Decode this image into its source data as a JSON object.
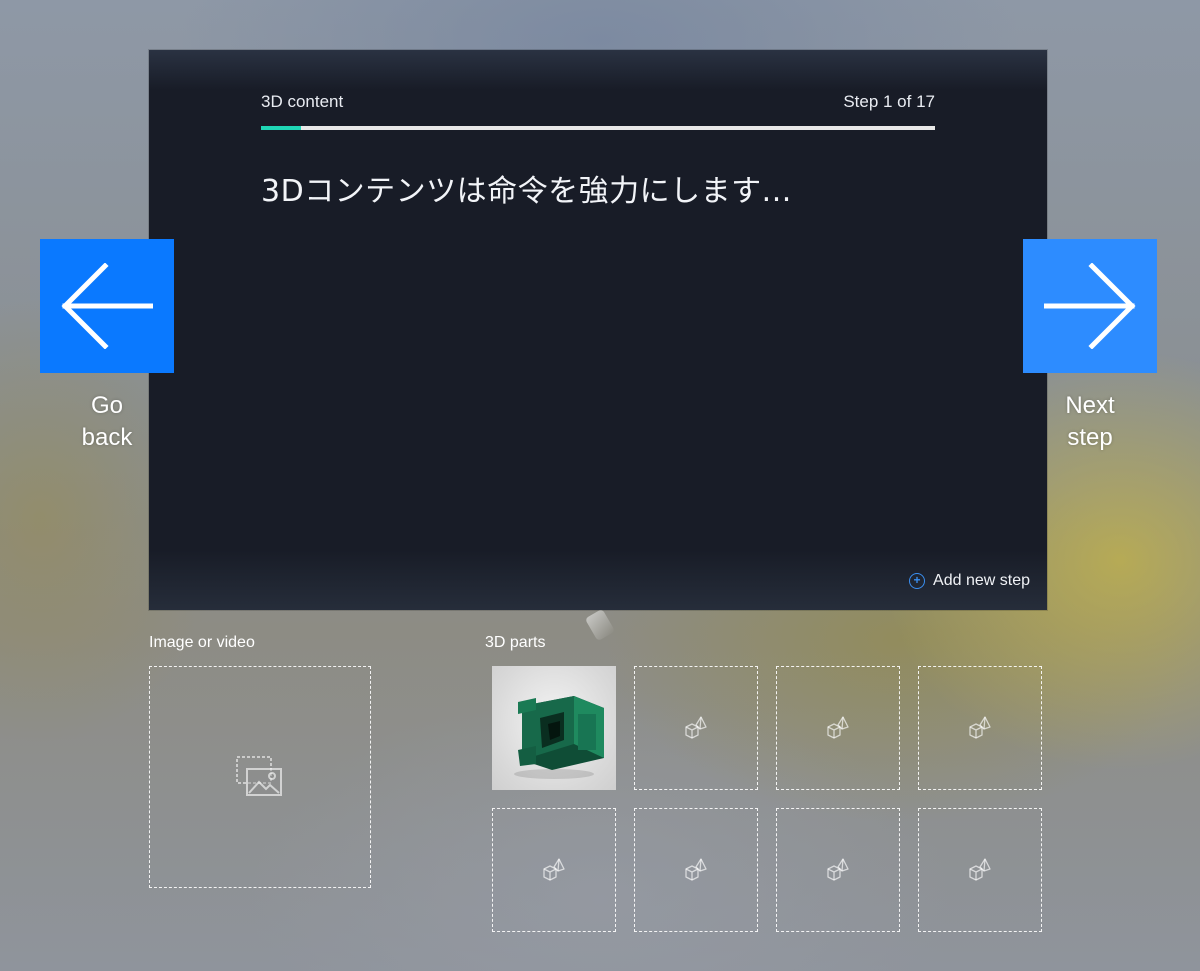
{
  "card": {
    "section_title": "3D content",
    "step_counter": "Step 1 of 17",
    "progress": {
      "current_step": 1,
      "total_steps": 17,
      "fraction": 0.06,
      "color": "#1fd6b5"
    },
    "instruction": "3Dコンテンツは命令を強力にします...",
    "add_step_label": "Add new step"
  },
  "nav": {
    "back_label_line1": "Go",
    "back_label_line2": "back",
    "next_label_line1": "Next",
    "next_label_line2": "step",
    "back_color": "#0a79ff",
    "next_color": "#2d8cff"
  },
  "media": {
    "image_video_label": "Image or video",
    "image_video_icon": "image-placeholder-icon"
  },
  "parts": {
    "label": "3D parts",
    "filled_slot_thumbnail": "green 3D part model",
    "empty_slot_icon": "3d-shapes-icon",
    "slots_total": 8,
    "slots_filled": 1
  }
}
